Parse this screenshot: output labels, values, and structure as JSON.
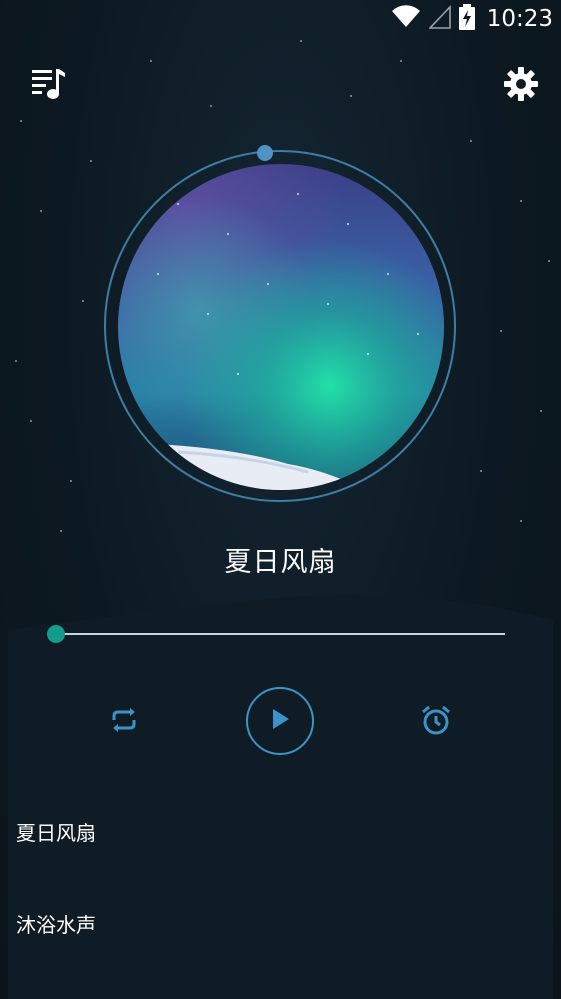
{
  "status_bar": {
    "time": "10:23",
    "icons": [
      "wifi-icon",
      "cell-signal-icon",
      "battery-charging-icon"
    ]
  },
  "header": {
    "left_icon": "playlist-music-icon",
    "right_icon": "gear-icon"
  },
  "player": {
    "now_playing_title": "夏日风扇",
    "progress": 0.0,
    "controls": {
      "repeat_icon": "repeat-icon",
      "play_icon": "play-icon",
      "timer_icon": "alarm-clock-icon"
    }
  },
  "playlist": {
    "items": [
      {
        "label": "夏日风扇"
      },
      {
        "label": "沐浴水声"
      }
    ]
  },
  "colors": {
    "background": "#0d1922",
    "accent_blue": "#3a94c9",
    "accent_teal": "#139c8c",
    "progress_track": "#c8d3da"
  }
}
